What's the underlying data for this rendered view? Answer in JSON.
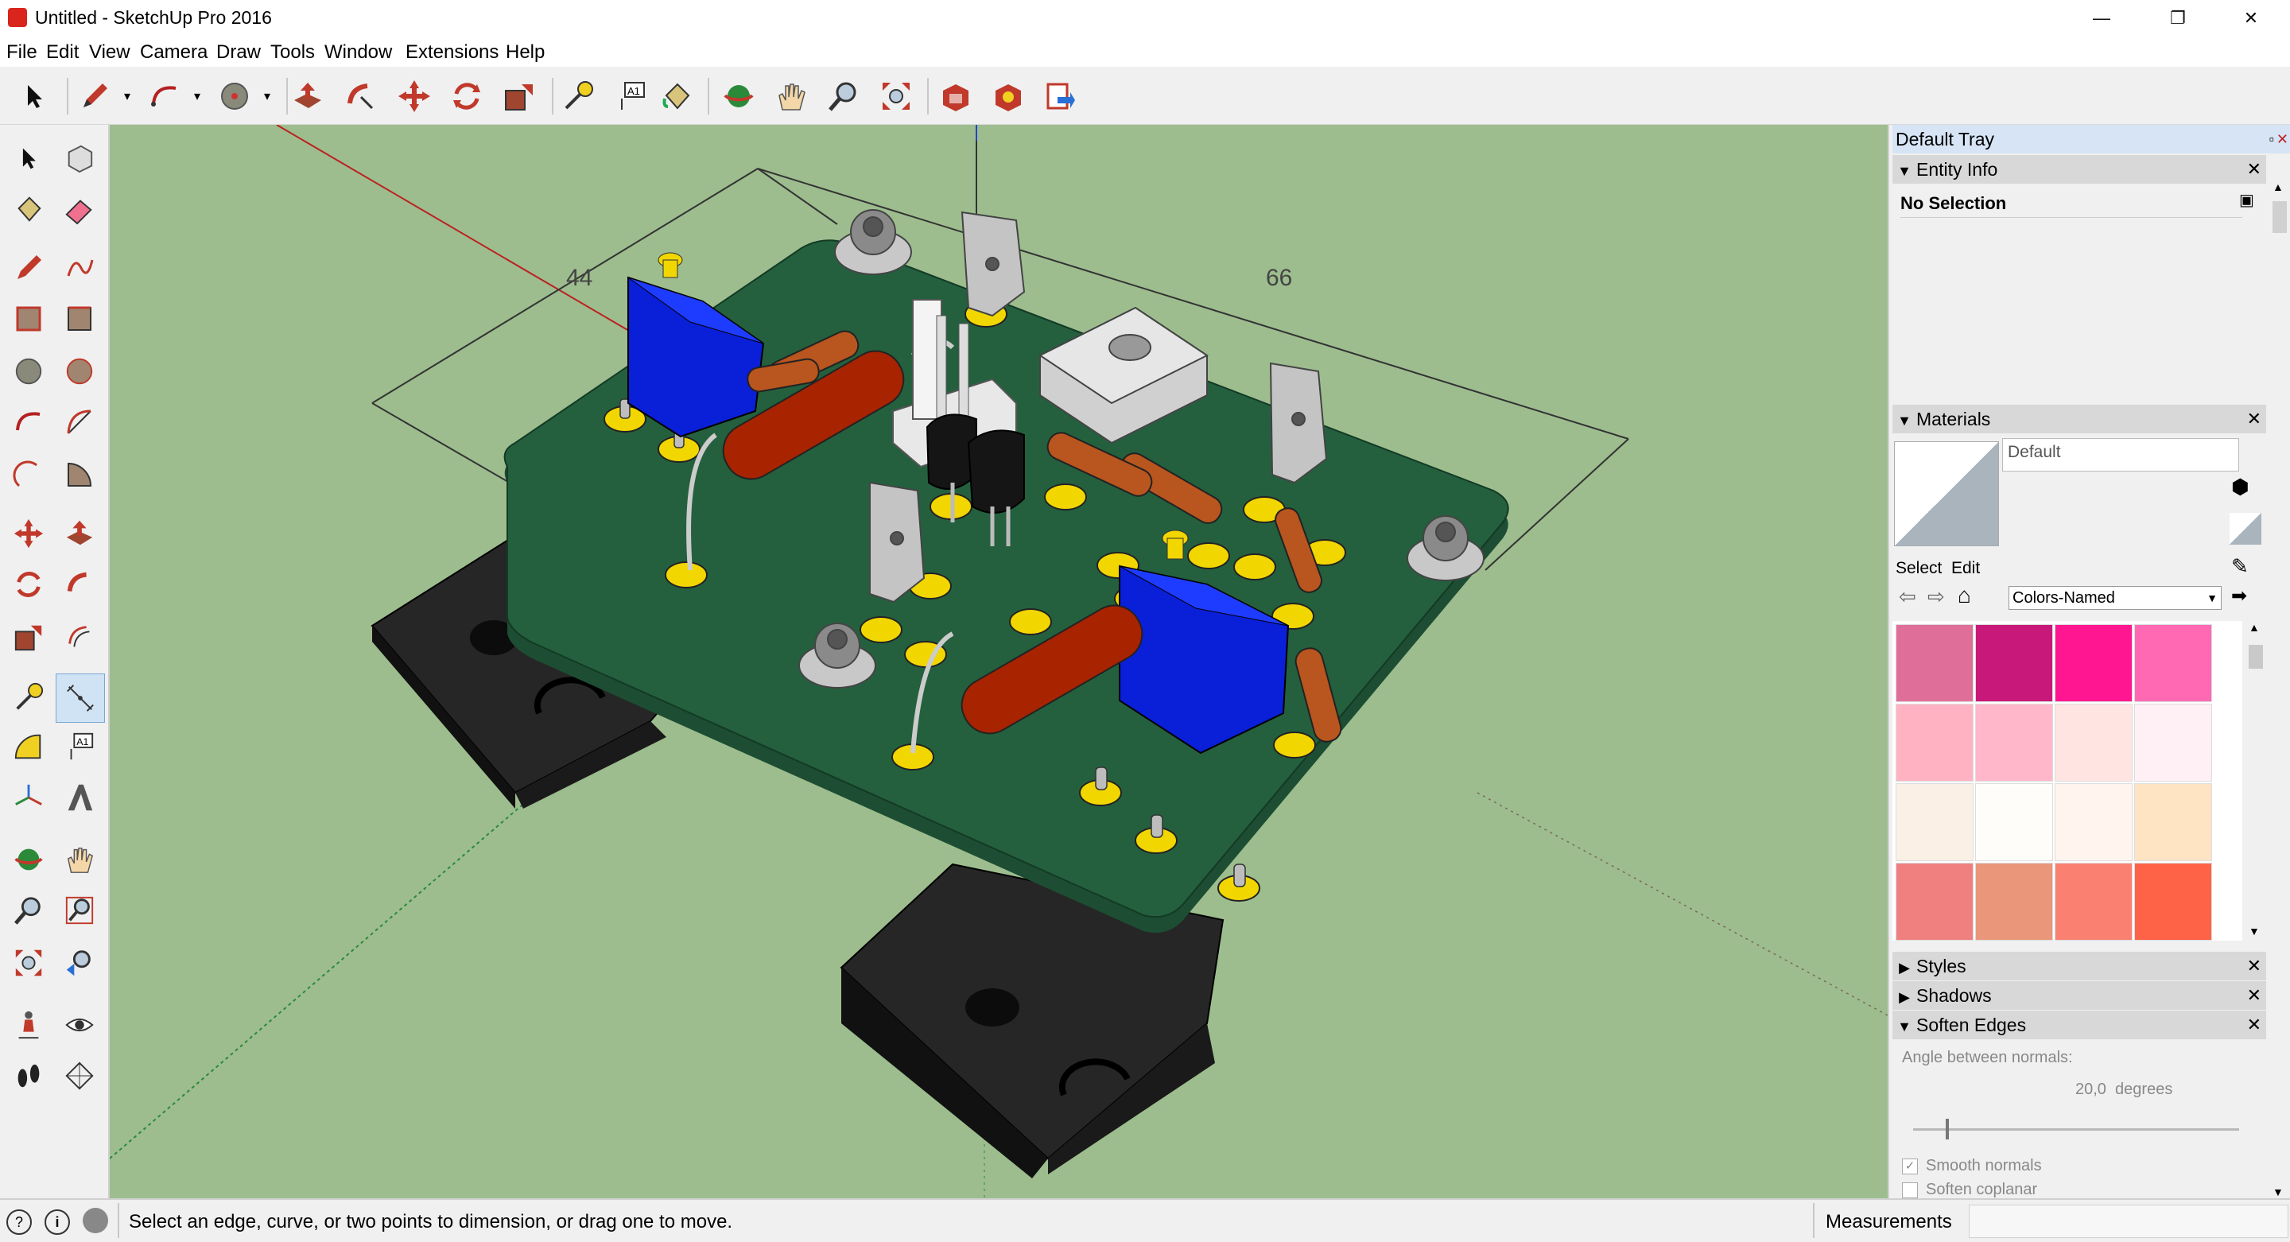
{
  "window": {
    "title": "Untitled - SketchUp Pro 2016",
    "controls": [
      "—",
      "❐",
      "✕"
    ]
  },
  "menu": [
    "File",
    "Edit",
    "View",
    "Camera",
    "Draw",
    "Tools",
    "Window",
    "Extensions",
    "Help"
  ],
  "toolbar_icons": [
    "select-icon",
    "pencil-icon",
    "arc-icon",
    "circle-icon",
    "push-pull-icon",
    "follow-me-icon",
    "move-icon",
    "rotate-icon",
    "scale-icon",
    "tape-measure-icon",
    "text-icon",
    "paint-bucket-icon",
    "orbit-icon",
    "pan-icon",
    "zoom-icon",
    "zoom-extents-icon",
    "warehouse-icon",
    "extension-warehouse-icon",
    "send-to-layout-icon"
  ],
  "viewport": {
    "dimension_labels": [
      "44",
      "66"
    ],
    "background_color": "#9dbd8e",
    "pcb_color": "#24603e"
  },
  "tray": {
    "title": "Default Tray",
    "entity_info": {
      "header": "Entity Info",
      "selection": "No Selection"
    },
    "materials": {
      "header": "Materials",
      "name_value": "Default",
      "tab_select": "Select",
      "tab_edit": "Edit",
      "library": "Colors-Named",
      "swatches": [
        "#df6f98",
        "#c8197a",
        "#ff1690",
        "#ff69b4",
        "#ffb3c2",
        "#ffb7c9",
        "#ffe4e1",
        "#fff0f5",
        "#faf0e6",
        "#fffdfa",
        "#fff5ee",
        "#ffe4c4",
        "#f08080",
        "#e9967a",
        "#fa8072",
        "#ff6347"
      ]
    },
    "styles_header": "Styles",
    "shadows_header": "Shadows",
    "soften_edges": {
      "header": "Soften Edges",
      "angle_label": "Angle between normals:",
      "angle_value": "20,0  degrees",
      "slider_fraction": 0.1,
      "smooth_normals_label": "Smooth normals",
      "soften_coplanar_label": "Soften coplanar",
      "smooth_normals_checked": true,
      "soften_coplanar_checked": false
    }
  },
  "status": {
    "message": "Select an edge, curve, or two points to dimension, or drag one to move.",
    "measurements_label": "Measurements"
  }
}
